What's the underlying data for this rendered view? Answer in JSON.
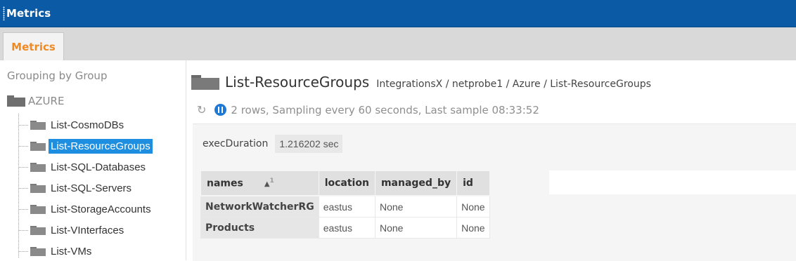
{
  "window": {
    "title": "Metrics"
  },
  "tabs": [
    {
      "label": "Metrics",
      "active": true
    }
  ],
  "sidebar": {
    "grouping_label": "Grouping by Group",
    "root": {
      "label": "AZURE",
      "icon": "folder-icon"
    },
    "items": [
      {
        "label": "List-CosmoDBs",
        "selected": false
      },
      {
        "label": "List-ResourceGroups",
        "selected": true
      },
      {
        "label": "List-SQL-Databases",
        "selected": false
      },
      {
        "label": "List-SQL-Servers",
        "selected": false
      },
      {
        "label": "List-StorageAccounts",
        "selected": false
      },
      {
        "label": "List-VInterfaces",
        "selected": false
      },
      {
        "label": "List-VMs",
        "selected": false
      }
    ]
  },
  "main": {
    "sample_name": "List-ResourceGroups",
    "path": "IntegrationsX / netprobe1 / Azure / List-ResourceGroups",
    "status": "2 rows, Sampling every 60 seconds, Last sample 08:33:52",
    "headline": {
      "name": "execDuration",
      "value": "1.216202 sec"
    },
    "table": {
      "columns": [
        "names",
        "location",
        "managed_by",
        "id"
      ],
      "sort": {
        "arrow": "▲",
        "index": "1"
      },
      "rows": [
        [
          "NetworkWatcherRG",
          "eastus",
          "None",
          "None"
        ],
        [
          "Products",
          "eastus",
          "None",
          "None"
        ]
      ]
    }
  },
  "colors": {
    "titlebar": "#0b5aa6",
    "active_tab_text": "#f08a24",
    "selection": "#1e8fe0",
    "pause_icon": "#1e78d6"
  }
}
